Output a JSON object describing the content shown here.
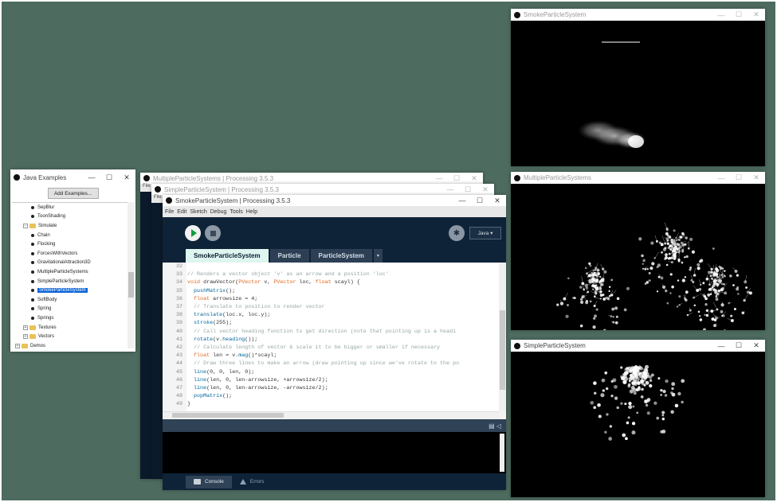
{
  "examples_window": {
    "title": "Java Examples",
    "controls": {
      "minimize": "—",
      "maximize": "☐",
      "close": "✕"
    },
    "add_button": "Add Examples...",
    "tree": [
      {
        "label": "SepBlur",
        "kind": "leaf",
        "indent": 2
      },
      {
        "label": "ToonShading",
        "kind": "leaf",
        "indent": 2
      },
      {
        "label": "Simulate",
        "kind": "folder-open",
        "indent": 1
      },
      {
        "label": "Chain",
        "kind": "leaf",
        "indent": 2
      },
      {
        "label": "Flocking",
        "kind": "leaf",
        "indent": 2
      },
      {
        "label": "ForcesWithVectors",
        "kind": "leaf",
        "indent": 2
      },
      {
        "label": "GravitationalAttraction3D",
        "kind": "leaf",
        "indent": 2
      },
      {
        "label": "MultipleParticleSystems",
        "kind": "leaf",
        "indent": 2
      },
      {
        "label": "SimpleParticleSystem",
        "kind": "leaf",
        "indent": 2
      },
      {
        "label": "SmokeParticleSystem",
        "kind": "leaf",
        "indent": 2,
        "selected": true
      },
      {
        "label": "SoftBody",
        "kind": "leaf",
        "indent": 2
      },
      {
        "label": "Spring",
        "kind": "leaf",
        "indent": 2
      },
      {
        "label": "Springs",
        "kind": "leaf",
        "indent": 2
      },
      {
        "label": "Textures",
        "kind": "folder",
        "indent": 1
      },
      {
        "label": "Vectors",
        "kind": "folder",
        "indent": 1
      },
      {
        "label": "Demos",
        "kind": "folder",
        "indent": 0
      }
    ]
  },
  "back_windows": {
    "back1_title": "MultipleParticleSystems | Processing 3.5.3",
    "back2_title": "SimpleParticleSystem | Processing 3.5.3",
    "menu_stub": "File"
  },
  "main_window": {
    "title": "SmokeParticleSystem | Processing 3.5.3",
    "menu": [
      "File",
      "Edit",
      "Sketch",
      "Debug",
      "Tools",
      "Help"
    ],
    "mode": "Java ▾",
    "tabs": [
      "SmokeParticleSystem",
      "Particle",
      "ParticleSystem"
    ],
    "tab_menu": "▾",
    "code": [
      {
        "n": "32",
        "parts": [
          [
            "",
            ""
          ]
        ]
      },
      {
        "n": "33",
        "parts": [
          [
            "c-com",
            "// Renders a vector object 'v' as an arrow and a position 'loc'"
          ]
        ]
      },
      {
        "n": "34",
        "parts": [
          [
            "c-kw",
            "void"
          ],
          [
            "",
            " drawVector("
          ],
          [
            "c-type",
            "PVector"
          ],
          [
            "",
            " v, "
          ],
          [
            "c-type",
            "PVector"
          ],
          [
            "",
            " loc, "
          ],
          [
            "c-type",
            "float"
          ],
          [
            "",
            " scayl) {"
          ]
        ]
      },
      {
        "n": "35",
        "parts": [
          [
            "",
            "  "
          ],
          [
            "c-fn",
            "pushMatrix"
          ],
          [
            "",
            "();"
          ]
        ]
      },
      {
        "n": "36",
        "parts": [
          [
            "",
            "  "
          ],
          [
            "c-type",
            "float"
          ],
          [
            "",
            " arrowsize = 4;"
          ]
        ]
      },
      {
        "n": "37",
        "parts": [
          [
            "c-com",
            "  // Translate to position to render vector"
          ]
        ]
      },
      {
        "n": "38",
        "parts": [
          [
            "",
            "  "
          ],
          [
            "c-fn",
            "translate"
          ],
          [
            "",
            "(loc.x, loc.y);"
          ]
        ]
      },
      {
        "n": "39",
        "parts": [
          [
            "",
            "  "
          ],
          [
            "c-fn",
            "stroke"
          ],
          [
            "",
            "(255);"
          ]
        ]
      },
      {
        "n": "40",
        "parts": [
          [
            "c-com",
            "  // Call vector heading function to get direction (note that pointing up is a headi"
          ]
        ]
      },
      {
        "n": "41",
        "parts": [
          [
            "",
            "  "
          ],
          [
            "c-fn",
            "rotate"
          ],
          [
            "",
            "(v."
          ],
          [
            "c-fn",
            "heading"
          ],
          [
            "",
            "());"
          ]
        ]
      },
      {
        "n": "42",
        "parts": [
          [
            "c-com",
            "  // Calculate length of vector & scale it to be bigger or smaller if necessary"
          ]
        ]
      },
      {
        "n": "43",
        "parts": [
          [
            "",
            "  "
          ],
          [
            "c-type",
            "float"
          ],
          [
            "",
            " len = v."
          ],
          [
            "c-fn",
            "mag"
          ],
          [
            "",
            "()*scayl;"
          ]
        ]
      },
      {
        "n": "44",
        "parts": [
          [
            "c-com",
            "  // Draw three lines to make an arrow (draw pointing up since we've rotate to the po"
          ]
        ]
      },
      {
        "n": "45",
        "parts": [
          [
            "",
            "  "
          ],
          [
            "c-fn",
            "line"
          ],
          [
            "",
            "(0, 0, len, 0);"
          ]
        ]
      },
      {
        "n": "46",
        "parts": [
          [
            "",
            "  "
          ],
          [
            "c-fn",
            "line"
          ],
          [
            "",
            "(len, 0, len-arrowsize, +arrowsize/2);"
          ]
        ]
      },
      {
        "n": "47",
        "parts": [
          [
            "",
            "  "
          ],
          [
            "c-fn",
            "line"
          ],
          [
            "",
            "(len, 0, len-arrowsize, -arrowsize/2);"
          ]
        ]
      },
      {
        "n": "48",
        "parts": [
          [
            "",
            "  "
          ],
          [
            "c-fn",
            "popMatrix"
          ],
          [
            "",
            "();"
          ]
        ]
      },
      {
        "n": "49",
        "parts": [
          [
            "",
            "}"
          ]
        ]
      }
    ],
    "console_tab": "Console",
    "errors_tab": "Errors"
  },
  "sketch_windows": {
    "smoke_title": "SmokeParticleSystem",
    "multi_title": "MultipleParticleSystems",
    "simple_title": "SimpleParticleSystem"
  }
}
